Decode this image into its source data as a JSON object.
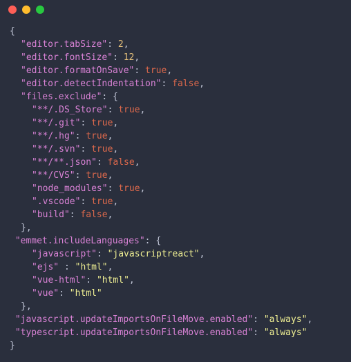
{
  "titlebar": {
    "dots": [
      "close",
      "minimize",
      "zoom"
    ]
  },
  "settings": {
    "scalars": [
      {
        "key": "editor.tabSize",
        "value": 2,
        "type": "num"
      },
      {
        "key": "editor.fontSize",
        "value": 12,
        "type": "num"
      },
      {
        "key": "editor.formatOnSave",
        "value": "true",
        "type": "bool"
      },
      {
        "key": "editor.detectIndentation",
        "value": "false",
        "type": "bool"
      }
    ],
    "filesExcludeKey": "files.exclude",
    "filesExclude": [
      {
        "key": "**/.DS_Store",
        "value": "true"
      },
      {
        "key": "**/.git",
        "value": "true"
      },
      {
        "key": "**/.hg",
        "value": "true"
      },
      {
        "key": "**/.svn",
        "value": "true"
      },
      {
        "key": "**/**.json",
        "value": "false"
      },
      {
        "key": "**/CVS",
        "value": "true"
      },
      {
        "key": "node_modules",
        "value": "true"
      },
      {
        "key": ".vscode",
        "value": "true"
      },
      {
        "key": "build",
        "value": "false"
      }
    ],
    "emmetKey": "emmet.includeLanguages",
    "emmet": [
      {
        "key": "javascript",
        "value": "javascriptreact"
      },
      {
        "key": "ejs",
        "value": "html",
        "space_before_colon": true
      },
      {
        "key": "vue-html",
        "value": "html"
      },
      {
        "key": "vue",
        "value": "html"
      }
    ],
    "tail": [
      {
        "key": "javascript.updateImportsOnFileMove.enabled",
        "value": "always"
      },
      {
        "key": "typescript.updateImportsOnFileMove.enabled",
        "value": "always"
      }
    ]
  }
}
